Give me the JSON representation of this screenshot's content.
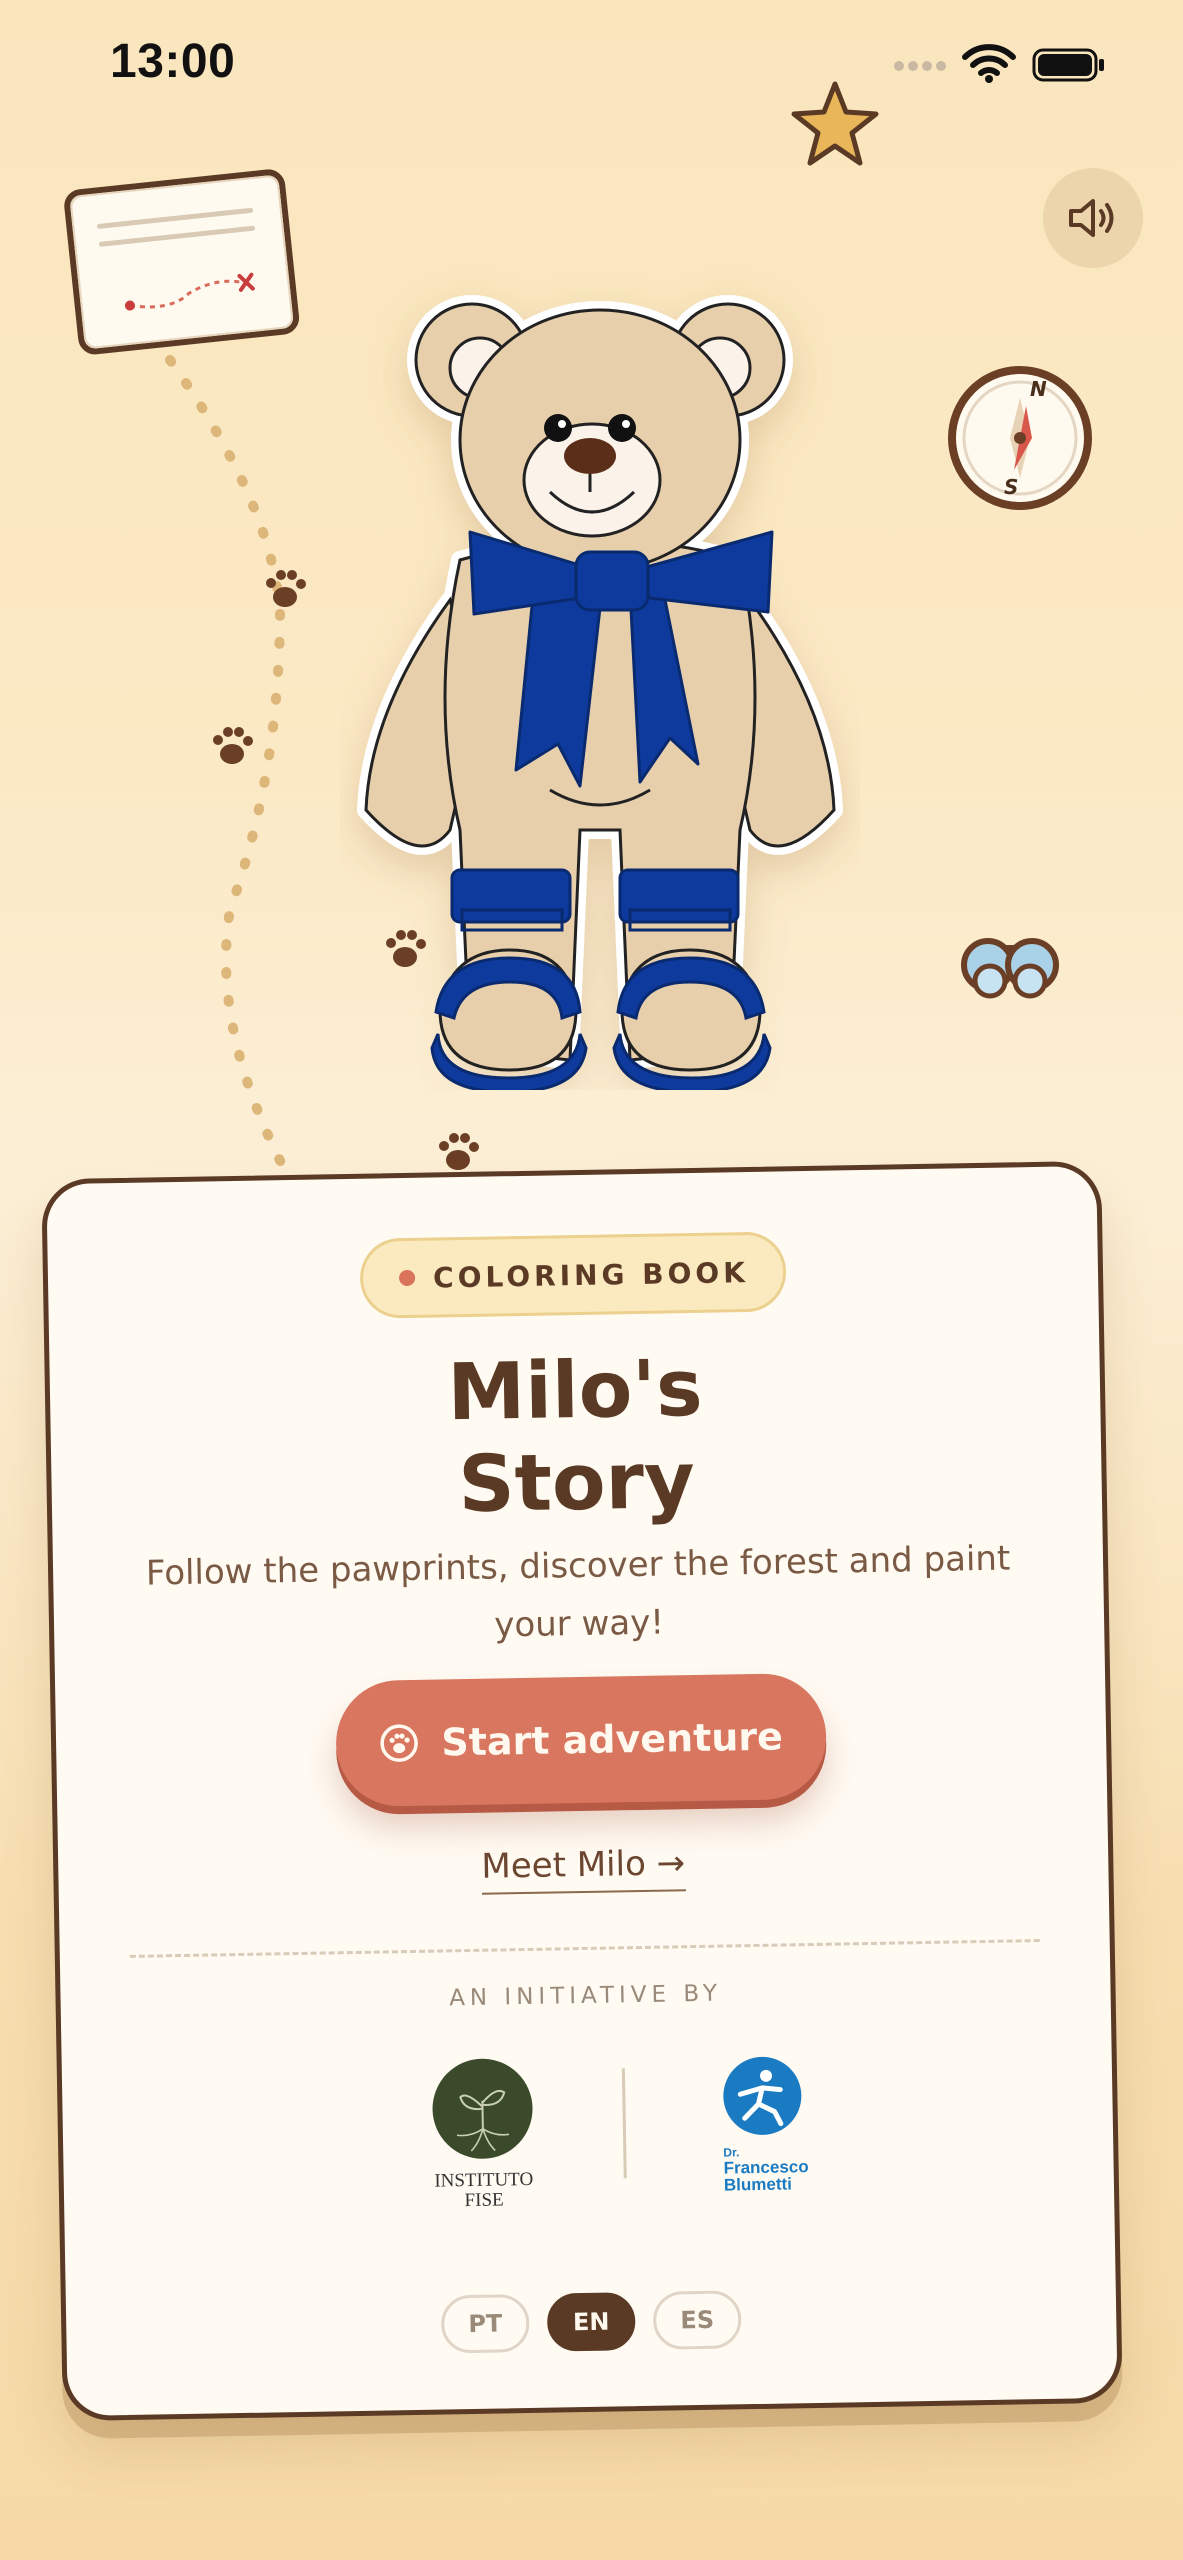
{
  "status_bar": {
    "time": "13:00"
  },
  "icons": {
    "signal": "signal-dots-icon",
    "wifi": "wifi-icon",
    "battery": "battery-icon",
    "sound": "speaker-icon",
    "star": "star-icon",
    "map": "treasure-map-icon",
    "compass": "compass-icon",
    "binoculars": "binoculars-icon",
    "pawprint": "pawprint-icon",
    "start": "paw-icon"
  },
  "hero": {
    "character": "teddy bear with blue bow and sandals"
  },
  "compass": {
    "north": "N",
    "south": "S"
  },
  "card": {
    "badge": "COLORING BOOK",
    "title_line1": "Milo's",
    "title_line2": "Story",
    "subtitle": "Follow the pawprints, discover the forest and paint your way!",
    "start_button": "Start adventure",
    "meet_link": "Meet Milo →",
    "initiative": "AN INITIATIVE BY",
    "partners": {
      "fise_line1": "INSTITUTO",
      "fise_line2": "FISE",
      "blumetti_line1": "Dr.",
      "blumetti_line2": "Francesco",
      "blumetti_line3": "Blumetti"
    },
    "languages": [
      "PT",
      "EN",
      "ES"
    ],
    "selected_language": "EN"
  },
  "colors": {
    "brand_brown": "#5a3a24",
    "accent_coral": "#d97660",
    "bow_blue": "#0d3a9c",
    "background": "#fbe9c5"
  }
}
